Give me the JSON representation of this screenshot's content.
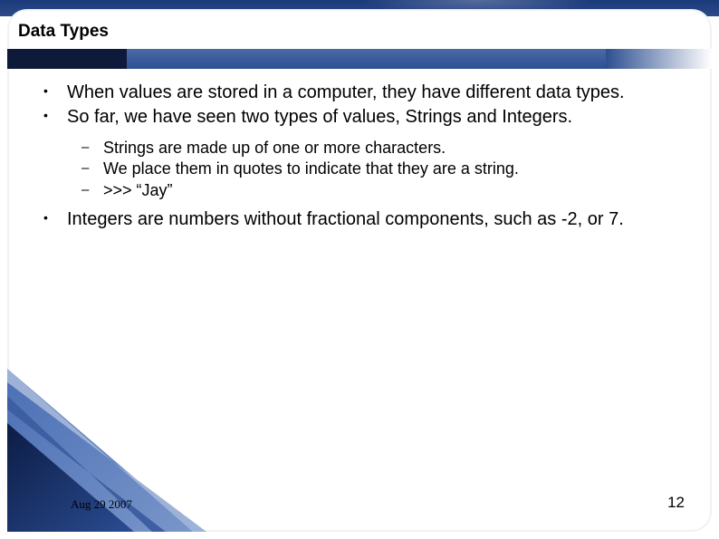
{
  "title": "Data Types",
  "bullets": {
    "b1": "When values are stored in a computer, they have different data types.",
    "b2": "So far, we have seen two types of values, Strings and Integers.",
    "sub": {
      "s1": "Strings are made up of one or more characters.",
      "s2": "We place them in quotes to indicate that they are a string.",
      "s3": ">>> “Jay”"
    },
    "b3": "Integers are numbers without fractional components, such as -2, or 7."
  },
  "footer": {
    "date": "Aug 29 2007",
    "page": "12"
  }
}
